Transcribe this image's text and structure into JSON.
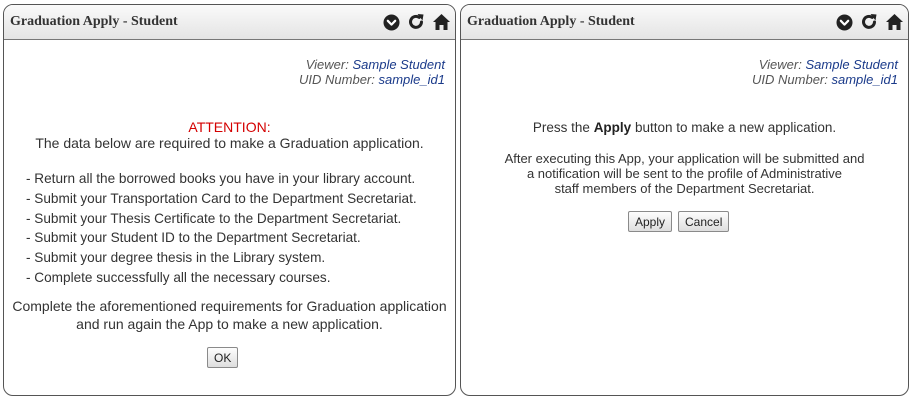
{
  "left_panel": {
    "title": "Graduation Apply - Student",
    "viewer_label": "Viewer:",
    "viewer_value": "Sample Student",
    "uid_label": "UID Number:",
    "uid_value": "sample_id1",
    "attention": "ATTENTION:",
    "intro": "The data below are required to make a Graduation application.",
    "requirements": [
      "- Return all the borrowed books you have in your library account.",
      "- Submit your Transportation Card to the Department Secretariat.",
      "- Submit your Thesis Certificate to the Department Secretariat.",
      "- Submit your Student ID to the Department Secretariat.",
      "- Submit your degree thesis in the Library system.",
      "- Complete successfully all the necessary courses."
    ],
    "closing_line1": "Complete the aforementioned requirements for Graduation application",
    "closing_line2": "and run again the App to make a new application.",
    "ok_label": "OK"
  },
  "right_panel": {
    "title": "Graduation Apply - Student",
    "viewer_label": "Viewer:",
    "viewer_value": "Sample Student",
    "uid_label": "UID Number:",
    "uid_value": "sample_id1",
    "press_prefix": "Press the",
    "press_bold": "Apply",
    "press_suffix": "button to make a new application.",
    "info_line1": "After executing this App, your application will be submitted and",
    "info_line2": "a notification will be sent to the profile of Administrative",
    "info_line3": "staff members of the Department Secretariat.",
    "apply_label": "Apply",
    "cancel_label": "Cancel"
  },
  "icons": [
    "chevron-down-circle-icon",
    "refresh-icon",
    "home-icon"
  ],
  "colors": {
    "attention": "#d40000",
    "viewer_value": "#1a3a8a"
  }
}
